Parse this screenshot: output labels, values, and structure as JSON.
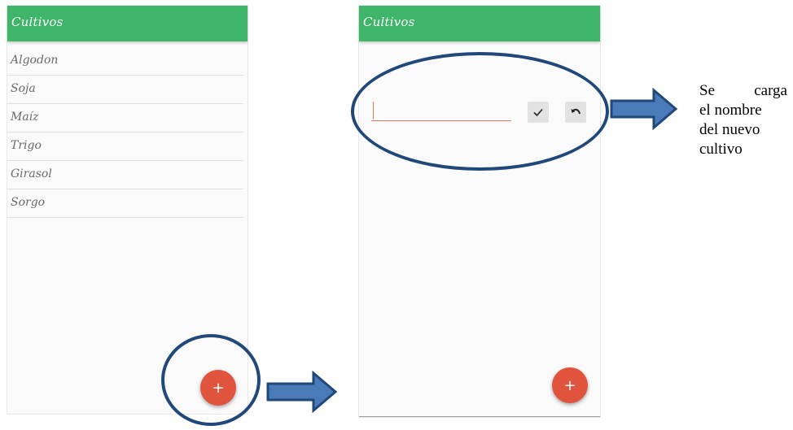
{
  "app": {
    "title": "Cultivos",
    "accent_color": "#3fb569",
    "fab_color": "#e0533c",
    "fab_label": "+"
  },
  "left_screen": {
    "title": "Cultivos",
    "items": [
      {
        "label": "Algodon"
      },
      {
        "label": "Soja"
      },
      {
        "label": "Maíz"
      },
      {
        "label": "Trigo"
      },
      {
        "label": "Girasol"
      },
      {
        "label": "Sorgo"
      }
    ]
  },
  "right_screen": {
    "title": "Cultivos",
    "input": {
      "value": "",
      "placeholder": ""
    },
    "confirm_icon": "check-icon",
    "undo_icon": "undo-icon"
  },
  "annotation": {
    "line1_a": "Se",
    "line1_b": "carga",
    "line2": "el nombre",
    "line3": "del nuevo",
    "line4": "cultivo",
    "arrow_color": "#4a7ab8",
    "outline_color": "#20487a"
  }
}
